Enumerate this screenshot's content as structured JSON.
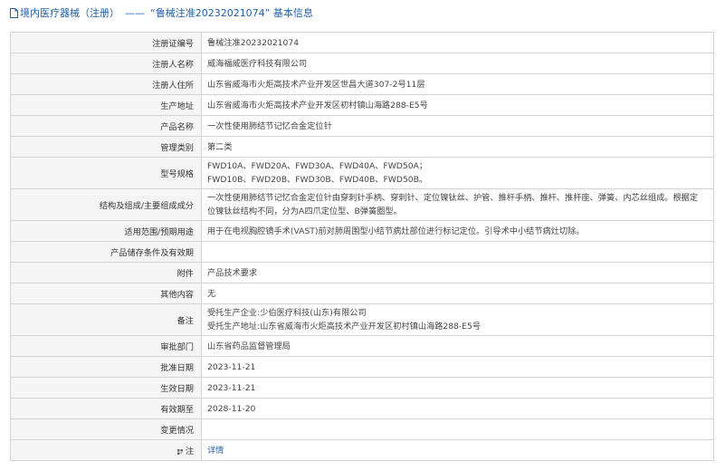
{
  "header": {
    "breadcrumb": "境内医疗器械（注册）",
    "dash": "——",
    "record_title": "“鲁械注准20232021074” 基本信息"
  },
  "rows": {
    "reg_no": {
      "label": "注册证编号",
      "value": "鲁械注准20232021074"
    },
    "registrant": {
      "label": "注册人名称",
      "value": "威海福威医疗科技有限公司"
    },
    "address": {
      "label": "注册人住所",
      "value": "山东省威海市火炬高技术产业开发区世昌大道307-2号11层"
    },
    "prod_address": {
      "label": "生产地址",
      "value": "山东省威海市火炬高技术产业开发区初村镇山海路288-E5号"
    },
    "product": {
      "label": "产品名称",
      "value": "一次性使用肺结节记忆合金定位针"
    },
    "category": {
      "label": "管理类别",
      "value": "第二类"
    },
    "models": {
      "label": "型号规格",
      "line1": "FWD10A、FWD20A、FWD30A、FWD40A、FWD50A；",
      "line2": "FWD10B、FWD20B、FWD30B、FWD40B、FWD50B。"
    },
    "structure": {
      "label": "结构及组成/主要组成成分",
      "value": "一次性使用肺结节记忆合金定位针由穿刺针手柄、穿刺针、定位镍钛丝、护管、推杆手柄、推杆、推杆座、弹簧、内芯丝组成。根据定位镍钛丝结构不同，分为A四爪定位型、B弹簧圈型。"
    },
    "scope": {
      "label": "适用范围/预期用途",
      "value": "用于在电视胸腔镜手术(VAST)前对肺周围型小结节病灶部位进行标记定位。引导术中小结节病灶切除。"
    },
    "storage": {
      "label": "产品储存条件及有效期",
      "value": ""
    },
    "attachment": {
      "label": "附件",
      "value": "产品技术要求"
    },
    "other": {
      "label": "其他内容",
      "value": "无"
    },
    "remark": {
      "label": "备注",
      "line1": "受托生产企业:少伯医疗科技(山东)有限公司",
      "line2": "受托生产地址:山东省威海市火炬高技术产业开发区初村镇山海路288-E5号"
    },
    "dept": {
      "label": "审批部门",
      "value": "山东省药品监督管理局"
    },
    "approve_date": {
      "label": "批准日期",
      "value": "2023-11-21"
    },
    "effective_date": {
      "label": "生效日期",
      "value": "2023-11-21"
    },
    "expiry": {
      "label": "有效期至",
      "value": "2028-11-20"
    },
    "changes": {
      "label": "变更情况",
      "value": ""
    },
    "note": {
      "label": "注",
      "link": "详情"
    }
  },
  "colors": {
    "link": "#1f5fa8",
    "label_bg": "#f5f5f5",
    "border": "#d3d3d3"
  }
}
